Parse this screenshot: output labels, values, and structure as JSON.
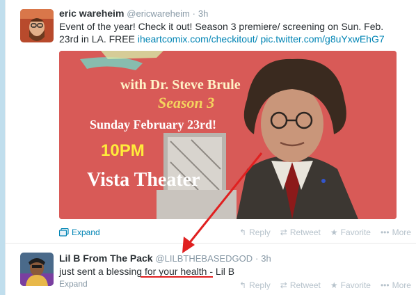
{
  "tweet1": {
    "fullname": "eric wareheim",
    "username": "@ericwareheim",
    "separator": "·",
    "time": "3h",
    "text_plain": "Event of the year! Check it out! Season 3 premiere/ screening on Sun. Feb. 23rd in LA. FREE ",
    "link1": "iheartcomix.com/checkitout/",
    "link2": "pic.twitter.com/g8uYxwEhG7",
    "media": {
      "with_line": "with Dr. Steve Brule",
      "season_line": "Season 3",
      "date_line": "Sunday February 23rd!",
      "time_line": "10PM",
      "venue_line": "Vista Theater",
      "background_color": "#d85a57"
    },
    "expand_label": "Expand",
    "actions": {
      "reply": "Reply",
      "retweet": "Retweet",
      "favorite": "Favorite",
      "more": "More"
    }
  },
  "tweet2": {
    "fullname": "Lil B From The Pack",
    "username": "@LILBTHEBASEDGOD",
    "separator": "·",
    "time": "3h",
    "text_before": "just sent a blessing ",
    "text_highlight": "for your health",
    "text_after": " - Lil B",
    "expand_label": "Expand",
    "actions": {
      "reply": "Reply",
      "retweet": "Retweet",
      "favorite": "Favorite",
      "more": "More"
    }
  },
  "colors": {
    "link": "#0084b4",
    "annotation": "#e02020",
    "background": "#c0deed"
  },
  "icons": [
    "reply-icon",
    "retweet-icon",
    "favorite-icon",
    "more-icon",
    "expand-photo-icon"
  ]
}
